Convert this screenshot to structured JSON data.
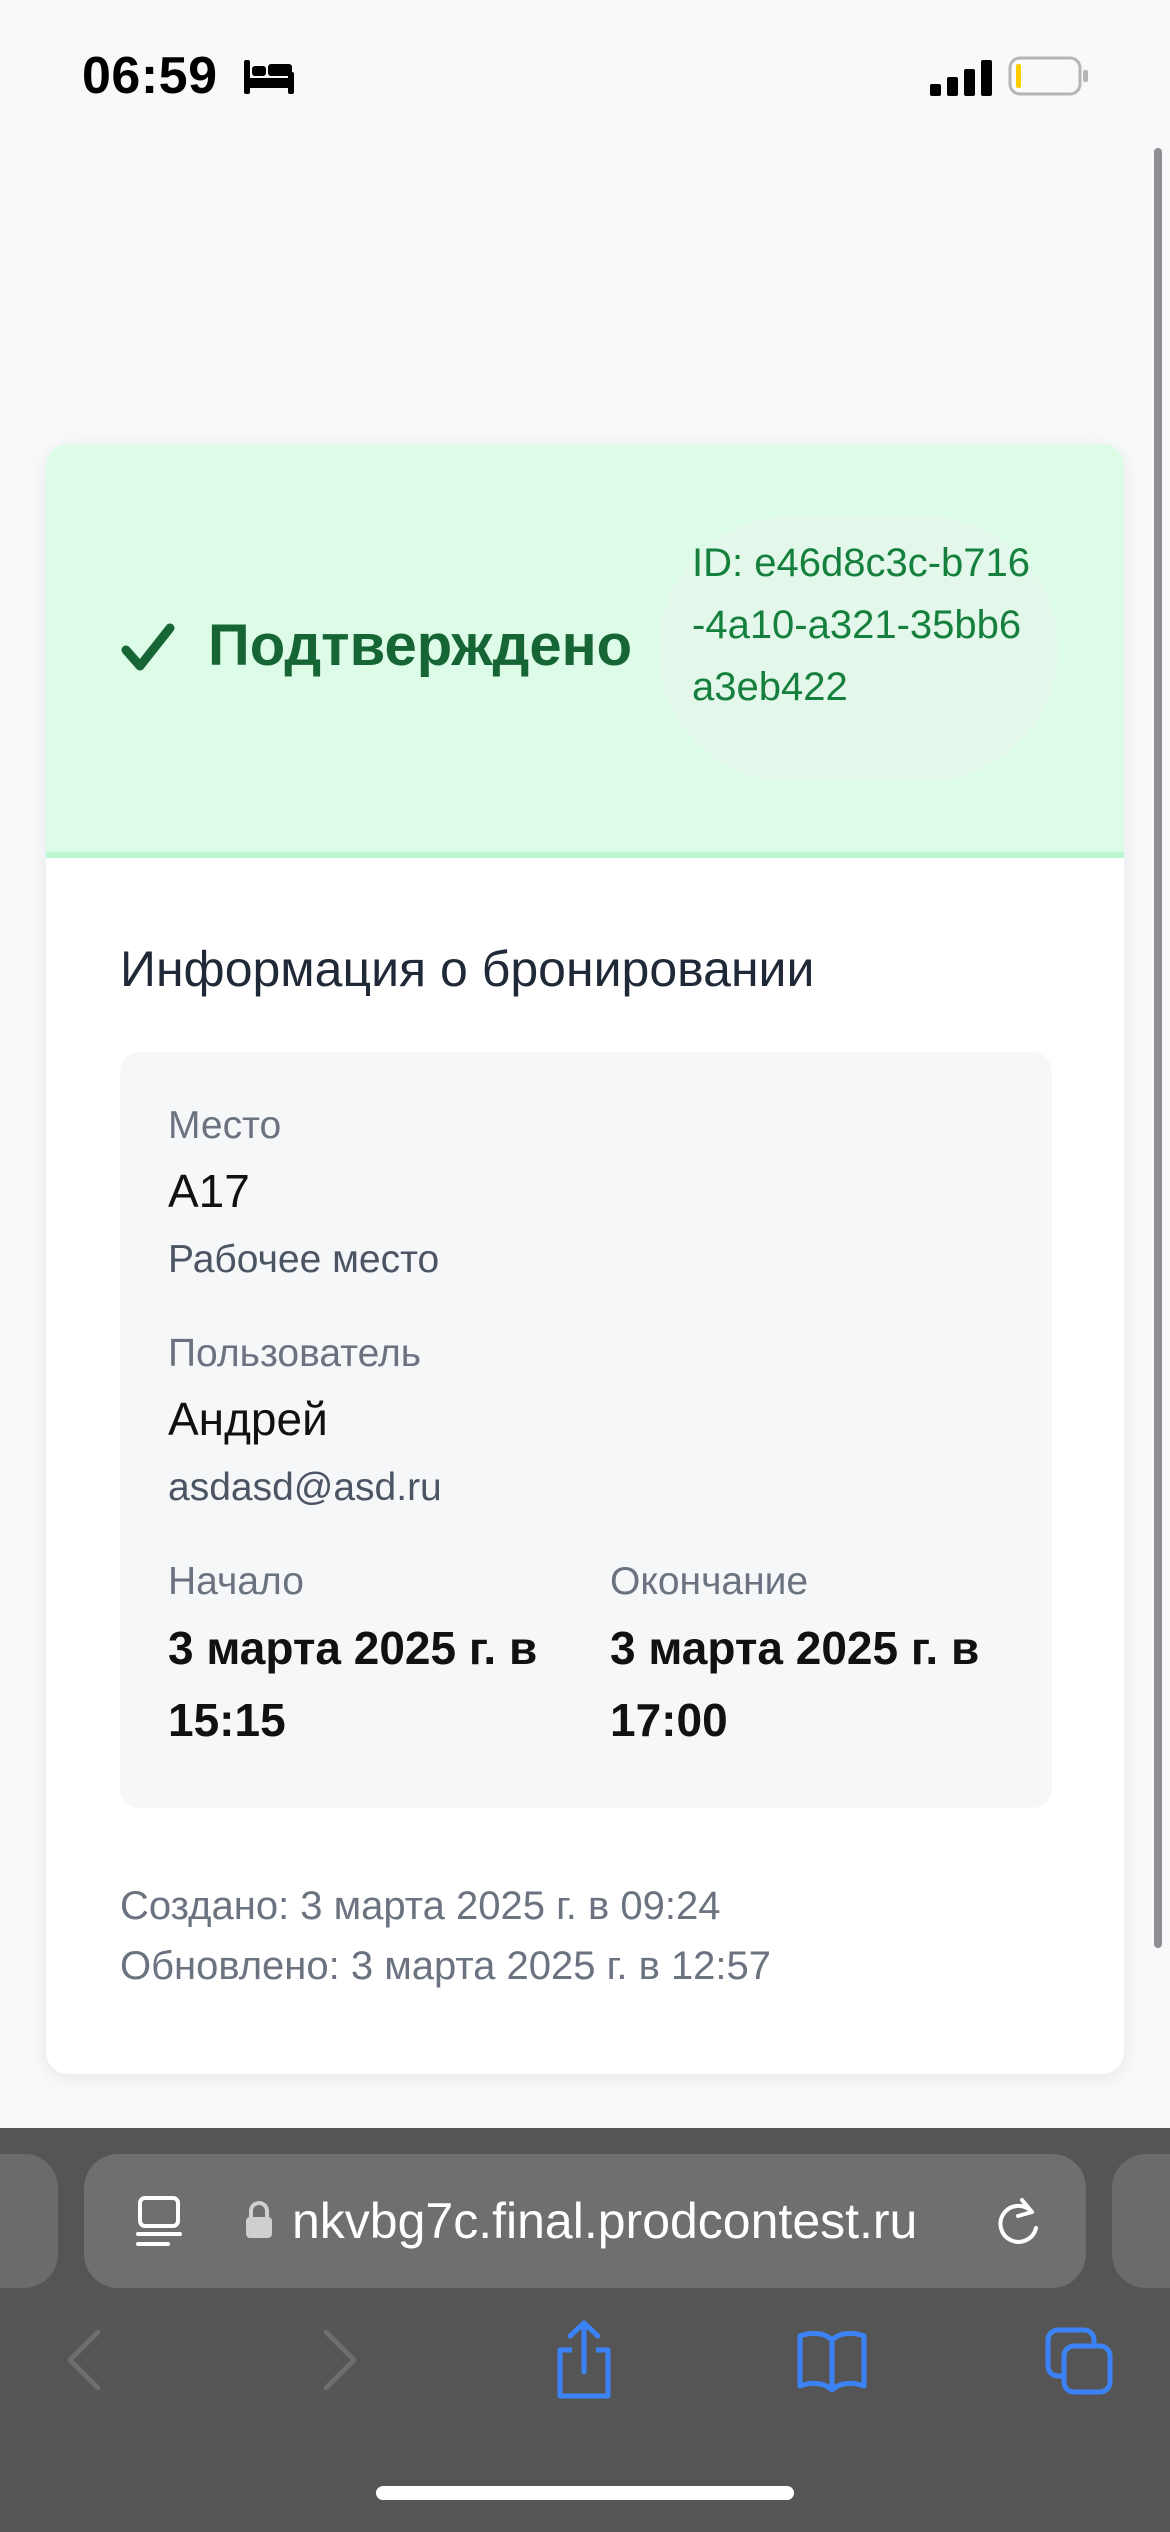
{
  "status_bar": {
    "time": "06:59"
  },
  "booking": {
    "status": "Подтверждено",
    "id_text": "ID: e46d8c3c-b716-4a10-a321-35bb6a3eb422",
    "section_title": "Информация о бронировании",
    "place": {
      "label": "Место",
      "value": "A17",
      "type": "Рабочее место"
    },
    "user": {
      "label": "Пользователь",
      "name": "Андрей",
      "email": "asdasd@asd.ru"
    },
    "start": {
      "label": "Начало",
      "value": "3 марта 2025 г. в 15:15"
    },
    "end": {
      "label": "Окончание",
      "value": "3 марта 2025 г. в 17:00"
    },
    "created": "Создано: 3 марта 2025 г. в 09:24",
    "updated": "Обновлено: 3 марта 2025 г. в 12:57"
  },
  "browser": {
    "url": "nkvbg7c.final.prodcontest.ru"
  },
  "colors": {
    "header_bg": "#dcfce7",
    "status_green": "#166534",
    "id_green": "#15803d",
    "toolbar_accent": "#3b82f6"
  },
  "icons": [
    "bed-icon",
    "signal-icon",
    "battery-icon",
    "check-icon",
    "reader-icon",
    "lock-icon",
    "reload-icon",
    "back-icon",
    "forward-icon",
    "share-icon",
    "bookmarks-icon",
    "tabs-icon"
  ]
}
